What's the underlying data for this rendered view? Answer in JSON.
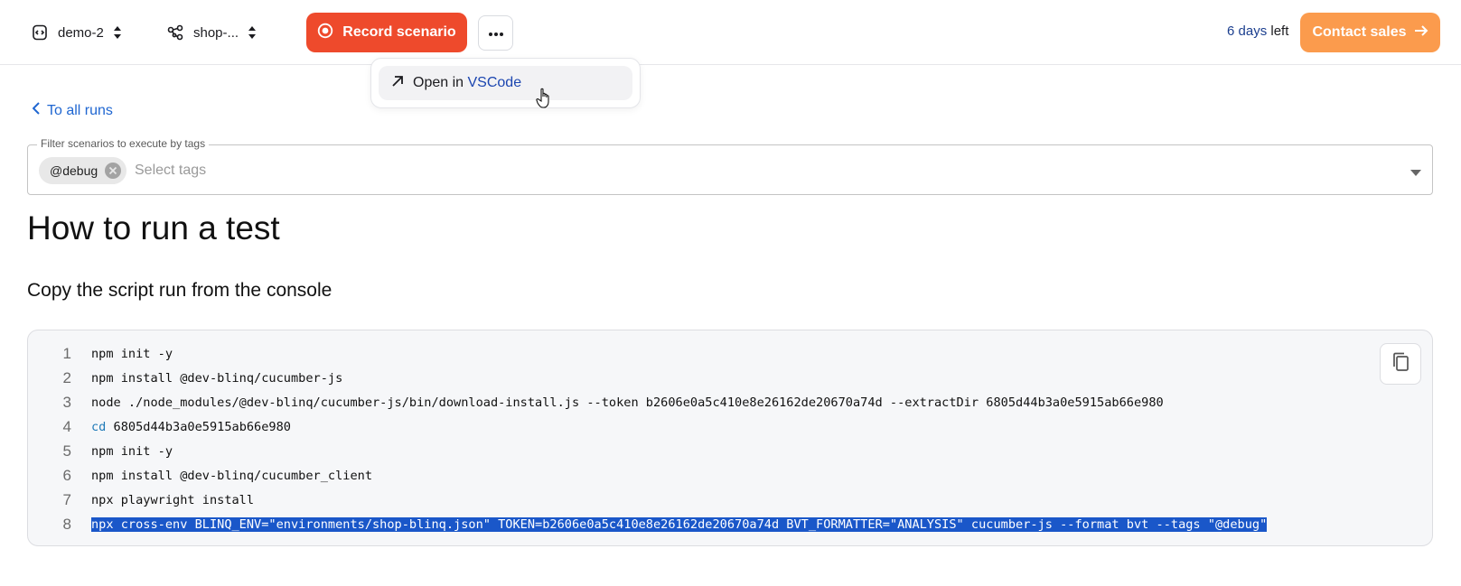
{
  "header": {
    "project": {
      "label": "demo-2",
      "icon": "project-code-icon"
    },
    "environment": {
      "label": "shop-...",
      "icon": "environment-nodes-icon"
    },
    "record_button": {
      "label": "Record scenario",
      "color": "#ee4a2c"
    },
    "more_button": {
      "icon": "ellipsis-icon"
    },
    "trial": {
      "days": "6 days",
      "suffix": "left"
    },
    "contact_button": {
      "label": "Contact sales",
      "color": "#fb9b4d"
    }
  },
  "menu": {
    "open_in_prefix": "Open in",
    "open_in_app": "VSCode"
  },
  "content": {
    "back_link": "To all runs",
    "filter": {
      "legend": "Filter scenarios to execute by tags",
      "chip": "@debug",
      "placeholder": "Select tags"
    },
    "title": "How to run a test",
    "subtitle": "Copy the script run from the console",
    "code": {
      "lines": [
        {
          "n": "1",
          "text": "npm init -y"
        },
        {
          "n": "2",
          "text": "npm install @dev-blinq/cucumber-js"
        },
        {
          "n": "3",
          "text": "node ./node_modules/@dev-blinq/cucumber-js/bin/download-install.js --token b2606e0a5c410e8e26162de20670a74d --extractDir 6805d44b3a0e5915ab66e980"
        },
        {
          "n": "4",
          "kw": "cd",
          "text": " 6805d44b3a0e5915ab66e980"
        },
        {
          "n": "5",
          "text": "npm init -y"
        },
        {
          "n": "6",
          "text": "npm install @dev-blinq/cucumber_client"
        },
        {
          "n": "7",
          "text": "npx playwright install"
        },
        {
          "n": "8",
          "text": "npx cross-env BLINQ_ENV=\"environments/shop-blinq.json\" TOKEN=b2606e0a5c410e8e26162de20670a74d BVT_FORMATTER=\"ANALYSIS\" cucumber-js --format bvt --tags \"@debug\""
        }
      ],
      "copy_icon": "copy-icon"
    }
  }
}
